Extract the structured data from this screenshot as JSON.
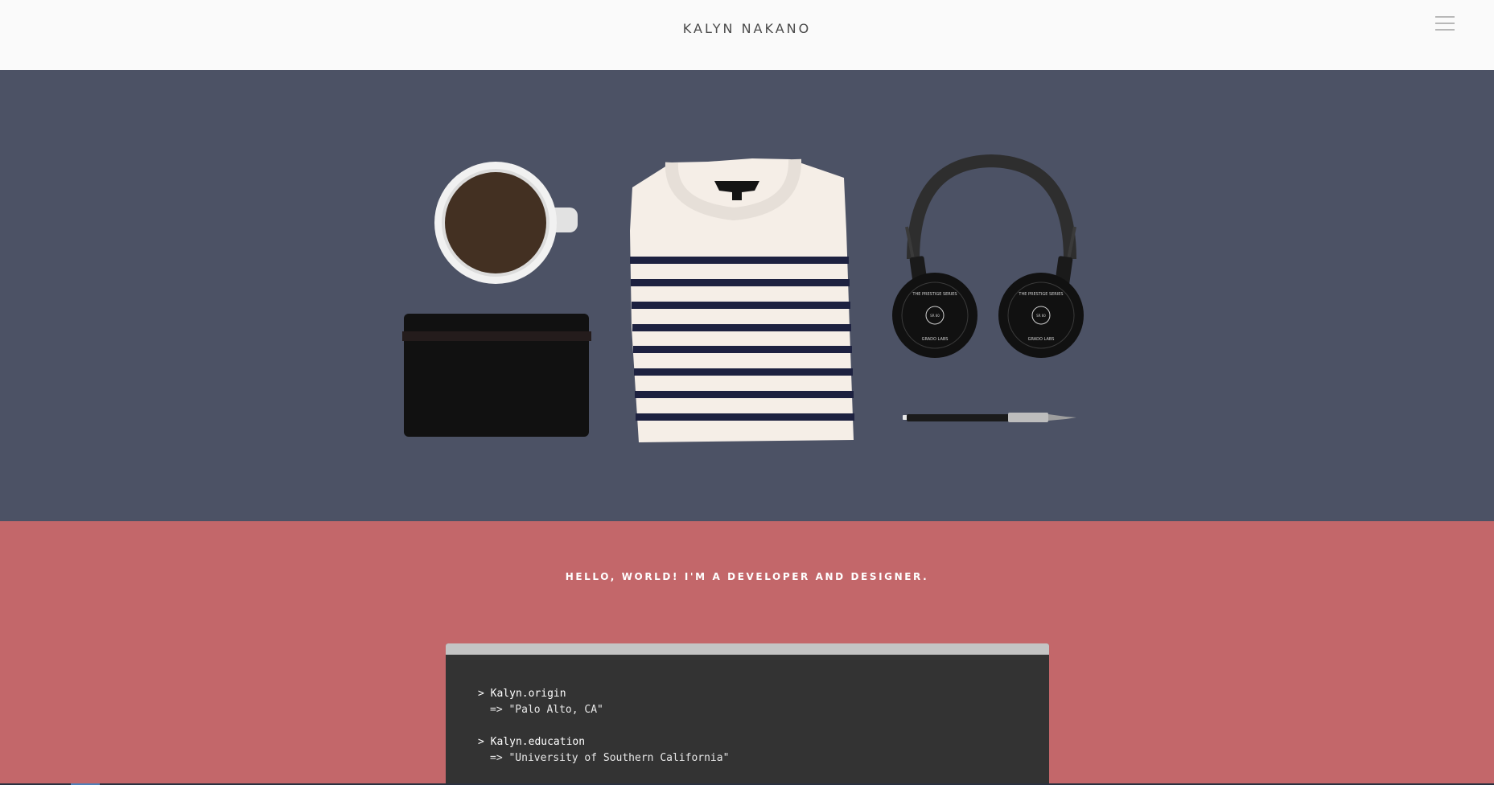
{
  "header": {
    "title": "KALYN NAKANO",
    "menu_icon": "hamburger-menu-icon"
  },
  "hero": {
    "background": "#4c5265",
    "illustrations": [
      "coffee-cup-icon",
      "wallet-icon",
      "striped-shirt-icon",
      "headphones-icon",
      "pencil-icon"
    ],
    "headphone_cup_text": "THE PRESTIGE SERIES",
    "headphone_cup_subtext": "GRADO LABS",
    "headphone_cup_model": "SR 60"
  },
  "intro": {
    "background": "#c3676a",
    "heading": "HELLO, WORLD! I'M A DEVELOPER AND DESIGNER.",
    "terminal": {
      "lines": [
        {
          "prompt": "> Kalyn.origin",
          "result": "=> \"Palo Alto, CA\""
        },
        {
          "prompt": "> Kalyn.education",
          "result": "=> \"University of Southern California\""
        }
      ]
    }
  }
}
